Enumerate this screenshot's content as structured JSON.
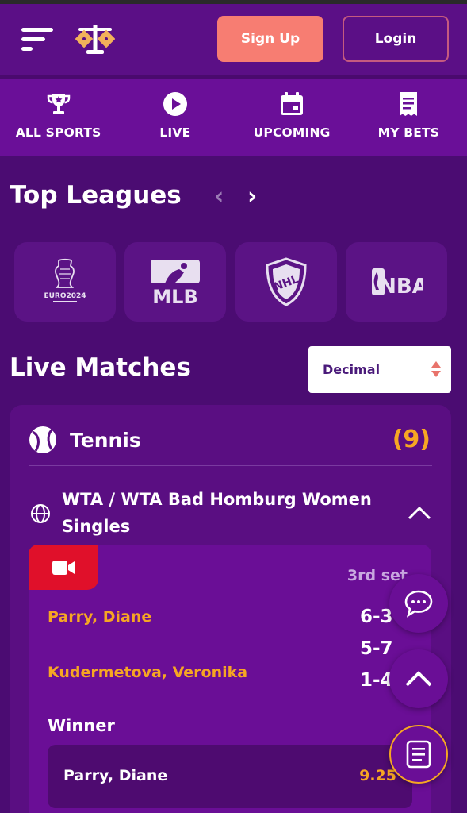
{
  "header": {
    "menu_icon": "hamburger-menu-icon",
    "logo_icon": "scales-logo-icon",
    "signup_label": "Sign Up",
    "login_label": "Login"
  },
  "nav": {
    "items": [
      {
        "label": "ALL SPORTS",
        "icon": "trophy-icon"
      },
      {
        "label": "LIVE",
        "icon": "play-icon"
      },
      {
        "label": "UPCOMING",
        "icon": "calendar-icon"
      },
      {
        "label": "MY BETS",
        "icon": "receipt-icon"
      }
    ]
  },
  "top_leagues": {
    "title": "Top Leagues",
    "leagues": [
      {
        "name": "EURO 2024",
        "logo_text": "EURO2024"
      },
      {
        "name": "MLB",
        "logo_text": "MLB"
      },
      {
        "name": "NHL",
        "logo_text": "NHL"
      },
      {
        "name": "NBA",
        "logo_text": "NBA"
      }
    ]
  },
  "live_matches": {
    "title": "Live Matches",
    "odds_format": "Decimal"
  },
  "sport": {
    "name": "Tennis",
    "count": "(9)",
    "league": "WTA / WTA Bad Homburg Women Singles"
  },
  "match": {
    "set_label": "3rd set",
    "players": [
      {
        "name": "Parry, Diane"
      },
      {
        "name": "Kudermetova, Veronika"
      }
    ],
    "scores": [
      "6-3",
      "5-7",
      "1-4"
    ],
    "market_label": "Winner",
    "bet": {
      "name": "Parry, Diane",
      "odd": "9.25"
    }
  },
  "colors": {
    "accent": "#f6a623",
    "signup": "#f77d72",
    "live_badge": "#e0102a",
    "background": "#4b0c72"
  }
}
